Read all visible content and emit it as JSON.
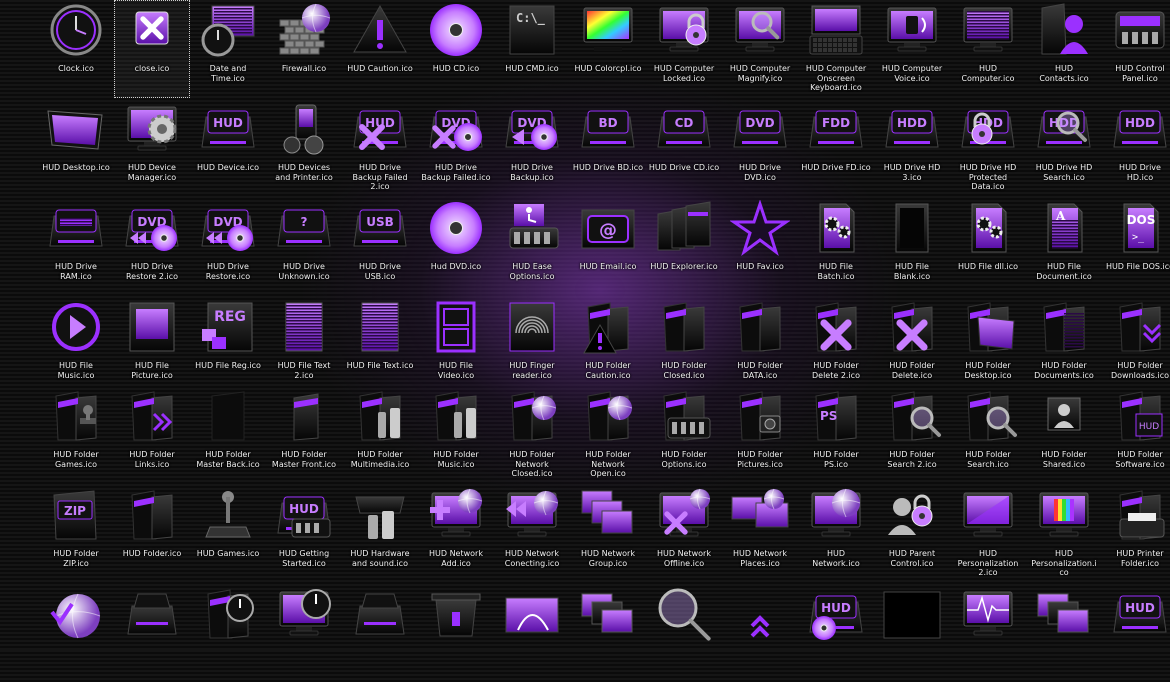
{
  "colors": {
    "accent": "#9b30ff",
    "accent_light": "#c77dff",
    "dark": "#0a0a0a",
    "label": "#f2f2f2"
  },
  "rows": [
    {
      "items": [
        {
          "icon": "partial-icon",
          "label": ""
        },
        {
          "icon": "clock-icon",
          "label": "Clock.ico"
        },
        {
          "icon": "close-icon",
          "label": "close.ico",
          "selected": true
        },
        {
          "icon": "calendar-clock-icon",
          "label": "Date and\nTime.ico"
        },
        {
          "icon": "firewall-icon",
          "label": "Firewall.ico"
        },
        {
          "icon": "caution-icon",
          "label": "HUD Caution.ico"
        },
        {
          "icon": "cd-icon",
          "label": "HUD CD.ico"
        },
        {
          "icon": "cmd-icon",
          "label": "HUD CMD.ico",
          "text": "C:\\_"
        },
        {
          "icon": "colorcpl-icon",
          "label": "HUD Colorcpl.ico"
        },
        {
          "icon": "monitor-lock-icon",
          "label": "HUD Computer\nLocked.ico"
        },
        {
          "icon": "monitor-magnify-icon",
          "label": "HUD Computer\nMagnify.ico"
        },
        {
          "icon": "keyboard-icon",
          "label": "HUD Computer\nOnscreen\nKeyboard.ico"
        },
        {
          "icon": "monitor-voice-icon",
          "label": "HUD Computer\nVoice.ico"
        },
        {
          "icon": "monitor-icon",
          "label": "HUD\nComputer.ico"
        },
        {
          "icon": "contacts-icon",
          "label": "HUD\nContacts.ico"
        },
        {
          "icon": "control-panel-icon",
          "label": "HUD Control\nPanel.ico"
        }
      ]
    },
    {
      "items": [
        {
          "icon": "partial-icon",
          "label": ""
        },
        {
          "icon": "desktop-icon",
          "label": "HUD Desktop.ico"
        },
        {
          "icon": "device-manager-icon",
          "label": "HUD Device\nManager.ico"
        },
        {
          "icon": "drive-label-icon",
          "label": "HUD Device.ico",
          "text": "HUD"
        },
        {
          "icon": "devices-printer-icon",
          "label": "HUD Devices\nand Printer.ico"
        },
        {
          "icon": "drive-failed-icon",
          "label": "HUD Drive\nBackup Failed\n2.ico",
          "text": "HUD"
        },
        {
          "icon": "drive-failed-disc-icon",
          "label": "HUD Drive\nBackup Failed.ico",
          "text": "DVD"
        },
        {
          "icon": "drive-backup-icon",
          "label": "HUD Drive\nBackup.ico",
          "text": "DVD"
        },
        {
          "icon": "drive-label-icon",
          "label": "HUD Drive BD.ico",
          "text": "BD"
        },
        {
          "icon": "drive-label-icon",
          "label": "HUD Drive CD.ico",
          "text": "CD"
        },
        {
          "icon": "drive-label-icon",
          "label": "HUD Drive\nDVD.ico",
          "text": "DVD"
        },
        {
          "icon": "drive-label-icon",
          "label": "HUD Drive FD.ico",
          "text": "FDD"
        },
        {
          "icon": "drive-label-icon",
          "label": "HUD Drive HD\n3.ico",
          "text": "HDD"
        },
        {
          "icon": "drive-lock-icon",
          "label": "HUD Drive HD\nProtected\nData.ico",
          "text": "HDD"
        },
        {
          "icon": "drive-search-icon",
          "label": "HUD Drive HD\nSearch.ico",
          "text": "HDD"
        },
        {
          "icon": "drive-label-icon",
          "label": "HUD Drive\nHD.ico",
          "text": "HDD"
        }
      ]
    },
    {
      "items": [
        {
          "icon": "partial-icon",
          "label": ""
        },
        {
          "icon": "ram-icon",
          "label": "HUD Drive\nRAM.ico"
        },
        {
          "icon": "drive-restore-icon",
          "label": "HUD Drive\nRestore 2.ico",
          "text": "DVD"
        },
        {
          "icon": "drive-restore-icon",
          "label": "HUD Drive\nRestore.ico",
          "text": "DVD"
        },
        {
          "icon": "drive-label-icon",
          "label": "HUD Drive\nUnknown.ico",
          "text": "?"
        },
        {
          "icon": "drive-label-icon",
          "label": "HUD Drive\nUSB.ico",
          "text": "USB"
        },
        {
          "icon": "cd-icon",
          "label": "Hud DVD.ico"
        },
        {
          "icon": "ease-access-icon",
          "label": "HUD Ease\nOptions.ico"
        },
        {
          "icon": "email-icon",
          "label": "HUD Email.ico",
          "text": "@"
        },
        {
          "icon": "explorer-icon",
          "label": "HUD Explorer.ico"
        },
        {
          "icon": "star-icon",
          "label": "HUD Fav.ico"
        },
        {
          "icon": "file-gears-icon",
          "label": "HUD File\nBatch.ico"
        },
        {
          "icon": "file-blank-icon",
          "label": "HUD File\nBlank.ico"
        },
        {
          "icon": "file-gears-icon",
          "label": "HUD File dll.ico"
        },
        {
          "icon": "file-document-icon",
          "label": "HUD File\nDocument.ico",
          "text": "A"
        },
        {
          "icon": "file-dos-icon",
          "label": "HUD File DOS.ico",
          "text": "DOS"
        }
      ]
    },
    {
      "items": [
        {
          "icon": "partial-icon",
          "label": ""
        },
        {
          "icon": "play-icon",
          "label": "HUD File\nMusic.ico"
        },
        {
          "icon": "picture-icon",
          "label": "HUD File\nPicture.ico"
        },
        {
          "icon": "file-reg-icon",
          "label": "HUD File Reg.ico",
          "text": "REG"
        },
        {
          "icon": "file-text-icon",
          "label": "HUD File Text\n2.ico"
        },
        {
          "icon": "file-text-icon",
          "label": "HUD File Text.ico"
        },
        {
          "icon": "film-icon",
          "label": "HUD File\nVideo.ico"
        },
        {
          "icon": "fingerprint-icon",
          "label": "HUD Finger\nreader.ico"
        },
        {
          "icon": "folder-caution-icon",
          "label": "HUD Folder\nCaution.ico"
        },
        {
          "icon": "folder-icon",
          "label": "HUD Folder\nClosed.ico"
        },
        {
          "icon": "folder-icon",
          "label": "HUD Folder\nDATA.ico"
        },
        {
          "icon": "folder-delete-icon",
          "label": "HUD Folder\nDelete 2.ico"
        },
        {
          "icon": "folder-delete-icon",
          "label": "HUD Folder\nDelete.ico"
        },
        {
          "icon": "folder-desktop-icon",
          "label": "HUD Folder\nDesktop.ico"
        },
        {
          "icon": "folder-documents-icon",
          "label": "HUD Folder\nDocuments.ico"
        },
        {
          "icon": "folder-downloads-icon",
          "label": "HUD Folder\nDownloads.ico"
        }
      ]
    },
    {
      "items": [
        {
          "icon": "partial-icon",
          "label": ""
        },
        {
          "icon": "folder-games-icon",
          "label": "HUD Folder\nGames.ico"
        },
        {
          "icon": "folder-links-icon",
          "label": "HUD Folder\nLinks.ico"
        },
        {
          "icon": "folder-back-icon",
          "label": "HUD Folder\nMaster Back.ico"
        },
        {
          "icon": "folder-front-icon",
          "label": "HUD Folder\nMaster Front.ico"
        },
        {
          "icon": "folder-multimedia-icon",
          "label": "HUD Folder\nMultimedia.ico"
        },
        {
          "icon": "folder-multimedia-icon",
          "label": "HUD Folder\nMusic.ico"
        },
        {
          "icon": "folder-network-icon",
          "label": "HUD Folder\nNetwork\nClosed.ico"
        },
        {
          "icon": "folder-network-icon",
          "label": "HUD Folder\nNetwork\nOpen.ico"
        },
        {
          "icon": "folder-options-icon",
          "label": "HUD Folder\nOptions.ico"
        },
        {
          "icon": "folder-camera-icon",
          "label": "HUD Folder\nPictures.ico"
        },
        {
          "icon": "folder-ps-icon",
          "label": "HUD Folder\nPS.ico",
          "text": "PS"
        },
        {
          "icon": "folder-search-icon",
          "label": "HUD Folder\nSearch 2.ico"
        },
        {
          "icon": "folder-search-icon",
          "label": "HUD Folder\nSearch.ico"
        },
        {
          "icon": "shared-user-icon",
          "label": "HUD Folder\nShared.ico"
        },
        {
          "icon": "folder-software-icon",
          "label": "HUD Folder\nSoftware.ico"
        }
      ]
    },
    {
      "items": [
        {
          "icon": "partial-icon",
          "label": ""
        },
        {
          "icon": "zip-icon",
          "label": "HUD Folder\nZIP.ico",
          "text": "ZIP"
        },
        {
          "icon": "folder-icon",
          "label": "HUD Folder.ico"
        },
        {
          "icon": "joystick-icon",
          "label": "HUD Games.ico"
        },
        {
          "icon": "getting-started-icon",
          "label": "HUD Getting\nStarted.ico",
          "text": "HUD"
        },
        {
          "icon": "hardware-sound-icon",
          "label": "HUD Hardware\nand sound.ico"
        },
        {
          "icon": "network-add-icon",
          "label": "HUD Network\nAdd.ico"
        },
        {
          "icon": "network-connecting-icon",
          "label": "HUD Network\nConecting.ico"
        },
        {
          "icon": "network-group-icon",
          "label": "HUD Network\nGroup.ico"
        },
        {
          "icon": "network-offline-icon",
          "label": "HUD Network\nOffline.ico"
        },
        {
          "icon": "network-places-icon",
          "label": "HUD Network\nPlaces.ico"
        },
        {
          "icon": "network-globe-icon",
          "label": "HUD\nNetwork.ico"
        },
        {
          "icon": "parent-control-icon",
          "label": "HUD Parent\nControl.ico"
        },
        {
          "icon": "personalization-icon",
          "label": "HUD\nPersonalization\n2.ico"
        },
        {
          "icon": "personalization-colors-icon",
          "label": "HUD\nPersonalization.i\nco"
        },
        {
          "icon": "printer-folder-icon",
          "label": "HUD Printer\nFolder.ico"
        }
      ]
    },
    {
      "items": [
        {
          "icon": "partial-icon",
          "label": ""
        },
        {
          "icon": "globe-check-icon",
          "label": ""
        },
        {
          "icon": "seat-icon",
          "label": ""
        },
        {
          "icon": "folder-clock-icon",
          "label": ""
        },
        {
          "icon": "monitor-clock-icon",
          "label": ""
        },
        {
          "icon": "seat-icon",
          "label": ""
        },
        {
          "icon": "recycle-icon",
          "label": ""
        },
        {
          "icon": "satellite-icon",
          "label": ""
        },
        {
          "icon": "windows-icon",
          "label": ""
        },
        {
          "icon": "magnifier-icon",
          "label": ""
        },
        {
          "icon": "arrows-up-icon",
          "label": ""
        },
        {
          "icon": "drive-disc-icon",
          "label": "",
          "text": "HUD"
        },
        {
          "icon": "black-screen-icon",
          "label": ""
        },
        {
          "icon": "pulse-icon",
          "label": ""
        },
        {
          "icon": "windows-icon",
          "label": ""
        },
        {
          "icon": "drive-label-icon",
          "label": "",
          "text": "HUD"
        }
      ]
    }
  ]
}
